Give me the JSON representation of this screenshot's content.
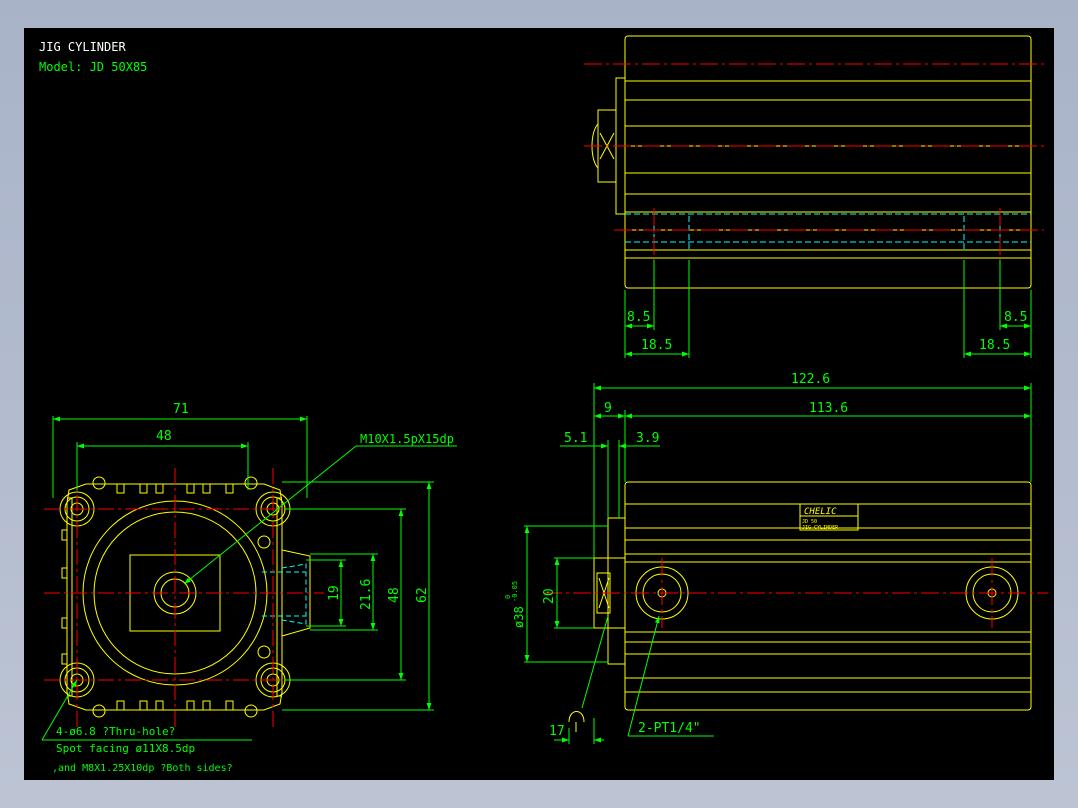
{
  "colors": {
    "background": "#000000",
    "outline": "#ffff00",
    "centerline": "#ff0000",
    "dimension": "#00ff00",
    "hidden": "#00ffff",
    "title": "#ffffff",
    "model": "#00ff00"
  },
  "title_block": {
    "title": "JIG CYLINDER",
    "model": "Model:  JD  50X85"
  },
  "dims": {
    "w71": "71",
    "w48": "48",
    "h62": "62",
    "h48": "48",
    "h21_6": "21.6",
    "h19": "19",
    "d122_6": "122.6",
    "d113_6": "113.6",
    "d9": "9",
    "d5_1": "5.1",
    "d3_9": "3.9",
    "d17": "17",
    "d8_5_left": "8.5",
    "d18_5_left": "18.5",
    "d8_5_right": "8.5",
    "d18_5_right": "18.5",
    "d20": "20",
    "d38": "ø38",
    "d38_tol_upper": "0",
    "d38_tol_lower": "-0.05"
  },
  "notes": {
    "thread": "M10X1.5pX15dp",
    "holes_line1": "4-ø6.8   ?Thru-hole?",
    "holes_line2": "Spot facing  ø11X8.5dp",
    "holes_line3": ",and M8X1.25X10dp ?Both sides?",
    "ports": "2-PT1/4\""
  },
  "label_plate": {
    "brand": "CHELIC",
    "line1": "JD 50",
    "line2": "JIG CYLINDER"
  }
}
